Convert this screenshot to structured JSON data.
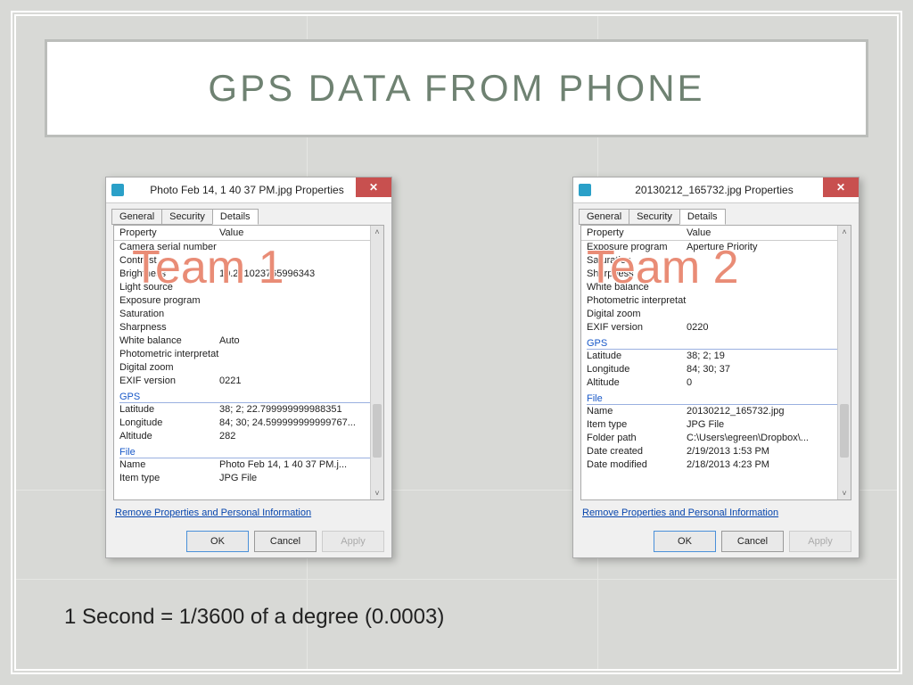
{
  "slide": {
    "title": "GPS DATA FROM PHONE",
    "footnote": "1 Second = 1/3600 of a degree (0.0003)",
    "team1_label": "Team 1",
    "team2_label": "Team 2"
  },
  "dialog_common": {
    "close_glyph": "✕",
    "tab_general": "General",
    "tab_security": "Security",
    "tab_details": "Details",
    "header_property": "Property",
    "header_value": "Value",
    "remove_link": "Remove Properties and Personal Information",
    "btn_ok": "OK",
    "btn_cancel": "Cancel",
    "btn_apply": "Apply",
    "scroll_up": "˄",
    "scroll_down": "˅"
  },
  "dialog1": {
    "title": "Photo Feb 14, 1 40 37 PM.jpg Properties",
    "rows": [
      [
        "Camera serial number",
        ""
      ],
      [
        "Contrast",
        ""
      ],
      [
        "Brightness",
        "10.271023765996343"
      ],
      [
        "Light source",
        ""
      ],
      [
        "Exposure program",
        ""
      ],
      [
        "Saturation",
        ""
      ],
      [
        "Sharpness",
        ""
      ],
      [
        "White balance",
        "Auto"
      ],
      [
        "Photometric interpretation",
        ""
      ],
      [
        "Digital zoom",
        ""
      ],
      [
        "EXIF version",
        "0221"
      ]
    ],
    "section_gps": "GPS",
    "gps_rows": [
      [
        "Latitude",
        "38; 2; 22.799999999988351"
      ],
      [
        "Longitude",
        "84; 30; 24.599999999999767..."
      ],
      [
        "Altitude",
        "282"
      ]
    ],
    "section_file": "File",
    "file_rows": [
      [
        "Name",
        "Photo Feb 14, 1 40 37 PM.j..."
      ],
      [
        "Item type",
        "JPG File"
      ]
    ]
  },
  "dialog2": {
    "title": "20130212_165732.jpg Properties",
    "rows": [
      [
        "Exposure program",
        "Aperture Priority"
      ],
      [
        "Saturation",
        ""
      ],
      [
        "Sharpness",
        ""
      ],
      [
        "White balance",
        ""
      ],
      [
        "Photometric interpretation",
        ""
      ],
      [
        "Digital zoom",
        ""
      ],
      [
        "EXIF version",
        "0220"
      ]
    ],
    "section_gps": "GPS",
    "gps_rows": [
      [
        "Latitude",
        "38; 2; 19"
      ],
      [
        "Longitude",
        "84; 30; 37"
      ],
      [
        "Altitude",
        "0"
      ]
    ],
    "section_file": "File",
    "file_rows": [
      [
        "Name",
        "20130212_165732.jpg"
      ],
      [
        "Item type",
        "JPG File"
      ],
      [
        "Folder path",
        "C:\\Users\\egreen\\Dropbox\\..."
      ],
      [
        "Date created",
        "2/19/2013 1:53 PM"
      ],
      [
        "Date modified",
        "2/18/2013 4:23 PM"
      ]
    ]
  }
}
